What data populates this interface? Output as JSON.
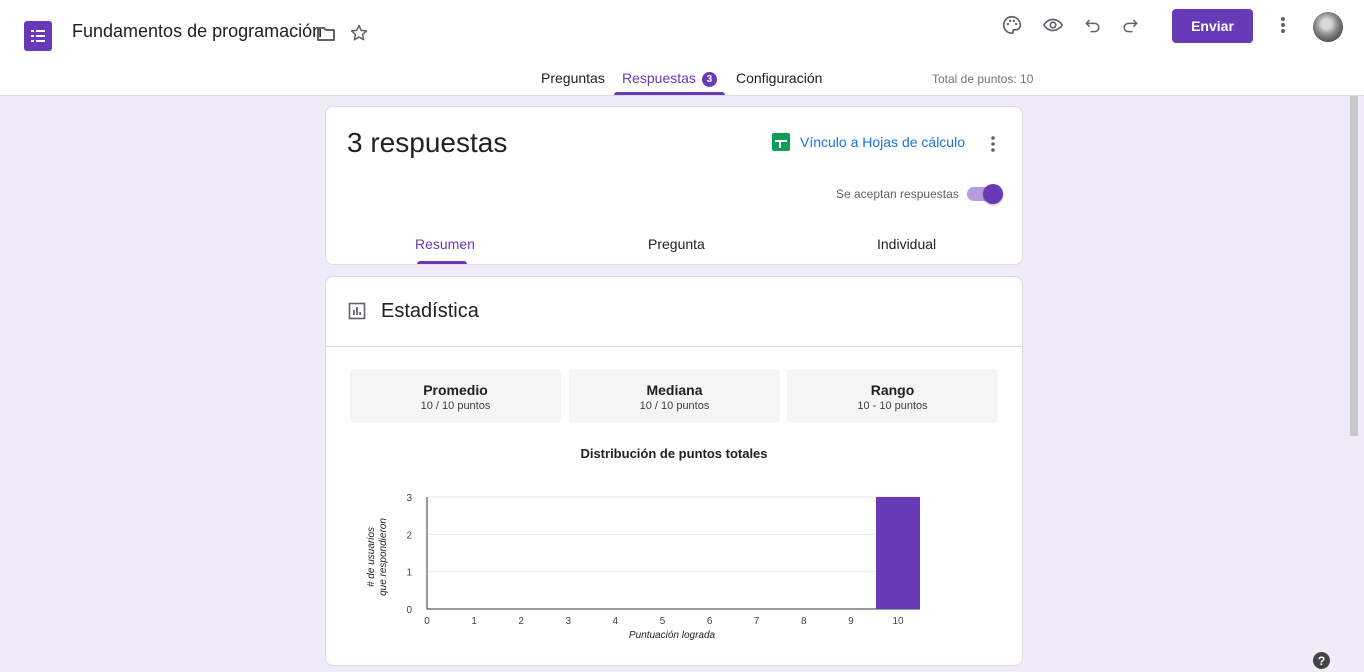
{
  "header": {
    "title": "Fundamentos de programación",
    "send_label": "Enviar",
    "help_icon": "?",
    "tabs": [
      {
        "label": "Preguntas"
      },
      {
        "label": "Respuestas",
        "badge": "3"
      },
      {
        "label": "Configuración"
      }
    ],
    "total_points": "Total de puntos: 10"
  },
  "summary": {
    "title": "3 respuestas",
    "sheets_link": "Vínculo a Hojas de cálculo",
    "accepting_label": "Se aceptan respuestas",
    "accepting_on": true,
    "subtabs": [
      "Resumen",
      "Pregunta",
      "Individual"
    ]
  },
  "stats": {
    "title": "Estadística",
    "boxes": [
      {
        "label": "Promedio",
        "value": "10 / 10 puntos"
      },
      {
        "label": "Mediana",
        "value": "10 / 10 puntos"
      },
      {
        "label": "Rango",
        "value": "10 - 10 puntos"
      }
    ]
  },
  "colors": {
    "accent": "#673ab7",
    "bar": "#673ab7",
    "link": "#1a73e8"
  },
  "chart_data": {
    "type": "bar",
    "title": "Distribución de puntos totales",
    "xlabel": "Puntuación lograda",
    "ylabel": "# de usuarios que respondieron",
    "categories": [
      "0",
      "1",
      "2",
      "3",
      "4",
      "5",
      "6",
      "7",
      "8",
      "9",
      "10"
    ],
    "values": [
      0,
      0,
      0,
      0,
      0,
      0,
      0,
      0,
      0,
      0,
      3
    ],
    "ylim": [
      0,
      3
    ],
    "yticks": [
      "0",
      "1",
      "2",
      "3"
    ],
    "grid": true
  }
}
